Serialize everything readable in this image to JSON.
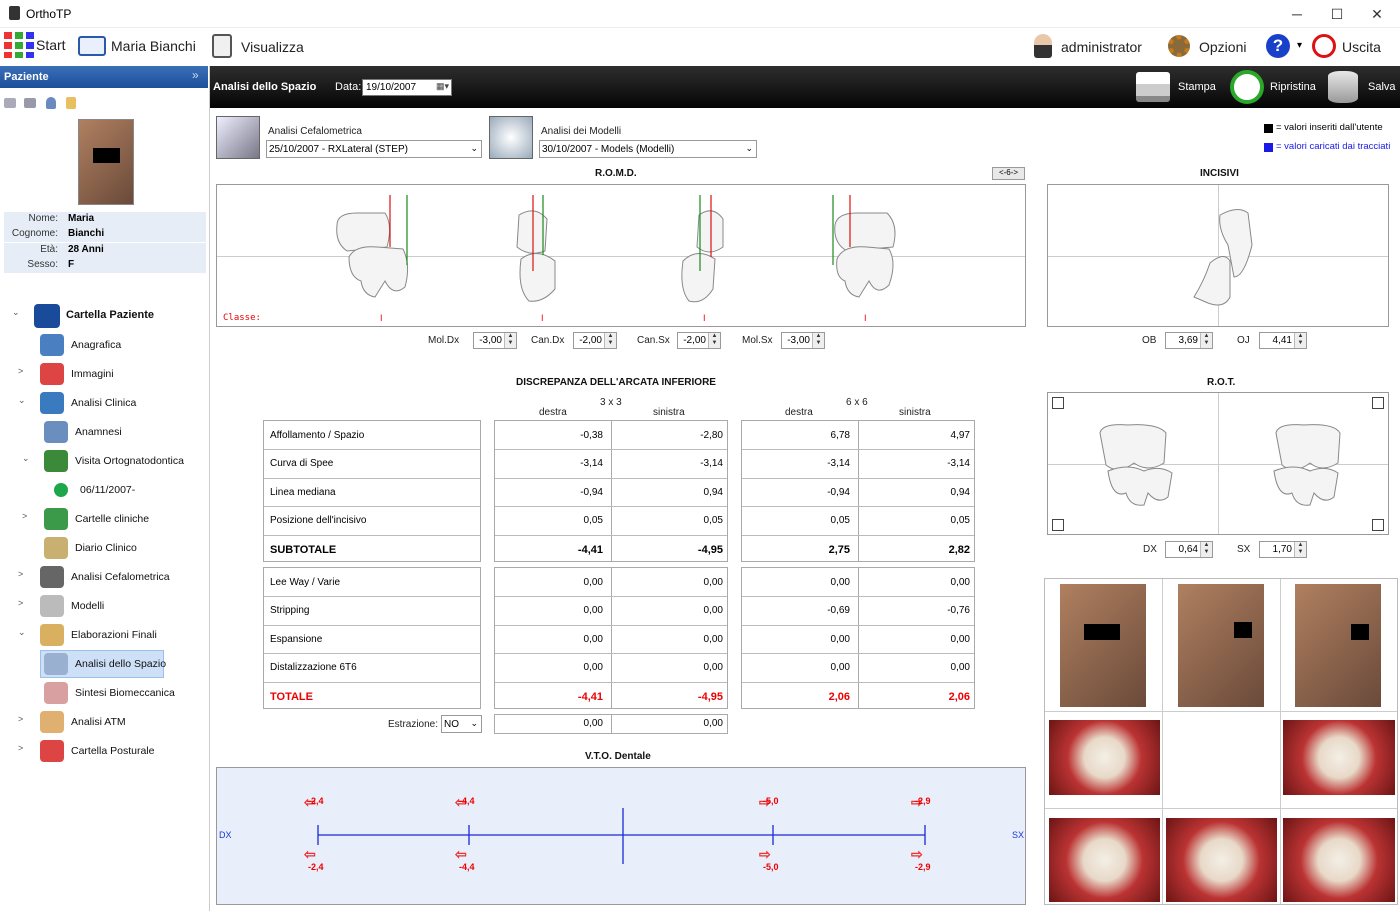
{
  "app": {
    "title": "OrthoTP"
  },
  "window": {
    "min": "─",
    "max": "☐",
    "close": "✕"
  },
  "menu": {
    "start": "Start",
    "patient": "Maria Bianchi",
    "view": "Visualizza",
    "user": "administrator",
    "options": "Opzioni",
    "help_arrow": "▾",
    "exit": "Uscita"
  },
  "sidebar": {
    "header": "Paziente",
    "chevron": "»",
    "info": [
      {
        "k": "Nome:",
        "v": "Maria"
      },
      {
        "k": "Cognome:",
        "v": "Bianchi"
      },
      {
        "k": "Età:",
        "v": "28 Anni"
      },
      {
        "k": "Sesso:",
        "v": "F"
      }
    ],
    "tree": [
      {
        "label": "Cartella Paziente",
        "arrow": "⌄",
        "icon": "folder-patient-icon",
        "color": "#1a4a9a"
      },
      {
        "label": "Anagrafica",
        "arrow": "",
        "icon": "person-icon",
        "color": "#4a7fc1"
      },
      {
        "label": "Immagini",
        "arrow": ">",
        "icon": "images-icon",
        "color": "#d44"
      },
      {
        "label": "Analisi Clinica",
        "arrow": "⌄",
        "icon": "stethoscope-icon",
        "color": "#3a7bbf"
      },
      {
        "label": "Anamnesi",
        "arrow": "",
        "icon": "clipboard-icon",
        "color": "#6a8fbf"
      },
      {
        "label": "Visita Ortognatodontica",
        "arrow": "⌄",
        "icon": "doctor-icon",
        "color": "#3a8a3a"
      },
      {
        "label": "06/11/2007-",
        "arrow": "",
        "icon": "green-dot-icon",
        "color": "#1ca84a"
      },
      {
        "label": "Cartelle cliniche",
        "arrow": ">",
        "icon": "clinic-records-icon",
        "color": "#3a9a4a"
      },
      {
        "label": "Diario Clinico",
        "arrow": "",
        "icon": "diary-icon",
        "color": "#c8b070"
      },
      {
        "label": "Analisi Cefalometrica",
        "arrow": ">",
        "icon": "skull-icon",
        "color": "#666"
      },
      {
        "label": "Modelli",
        "arrow": ">",
        "icon": "teeth-model-icon",
        "color": "#bbb"
      },
      {
        "label": "Elaborazioni Finali",
        "arrow": "⌄",
        "icon": "head-icon",
        "color": "#d8b060"
      },
      {
        "label": "Analisi dello Spazio",
        "arrow": "",
        "icon": "space-analysis-icon",
        "color": "#9ab0d0"
      },
      {
        "label": "Sintesi Biomeccanica",
        "arrow": "",
        "icon": "biomech-icon",
        "color": "#d8a0a0"
      },
      {
        "label": "Analisi ATM",
        "arrow": ">",
        "icon": "atm-icon",
        "color": "#e0b070"
      },
      {
        "label": "Cartella Posturale",
        "arrow": ">",
        "icon": "posture-icon",
        "color": "#d44"
      }
    ]
  },
  "header": {
    "title": "Analisi dello Spazio",
    "date_label": "Data:",
    "date_value": "19/10/2007",
    "print": "Stampa",
    "restore": "Ripristina",
    "save": "Salva"
  },
  "sources": {
    "ceph_label": "Analisi Cefalometrica",
    "ceph_value": "25/10/2007  - RXLateral (STEP)",
    "models_label": "Analisi dei Modelli",
    "models_value": "30/10/2007  - Models (Modelli)"
  },
  "legend": {
    "user": "= valori inseriti dall'utente",
    "traced": "= valori caricati dai tracciati",
    "user_color": "#000000",
    "traced_color": "#1a1ae6"
  },
  "romd": {
    "title": "R.O.M.D.",
    "toggle": "<-6->",
    "classe_label": "Classe:",
    "classes": [
      "I",
      "I",
      "I",
      "I"
    ],
    "fields": [
      {
        "label": "Mol.Dx",
        "value": "-3,00"
      },
      {
        "label": "Can.Dx",
        "value": "-2,00"
      },
      {
        "label": "Can.Sx",
        "value": "-2,00"
      },
      {
        "label": "Mol.Sx",
        "value": "-3,00"
      }
    ]
  },
  "incisivi": {
    "title": "INCISIVI",
    "ob_label": "OB",
    "ob_value": "3,69",
    "oj_label": "OJ",
    "oj_value": "4,41"
  },
  "rot": {
    "title": "R.O.T.",
    "dx_label": "DX",
    "dx_value": "0,64",
    "sx_label": "SX",
    "sx_value": "1,70"
  },
  "discrepanza": {
    "title": "DISCREPANZA DELL'ARCATA INFERIORE",
    "g1": "3 x 3",
    "g2": "6 x 6",
    "destra": "destra",
    "sinistra": "sinistra",
    "rows1": [
      {
        "label": "Affollamento / Spazio",
        "v": [
          "-0,38",
          "-2,80",
          "6,78",
          "4,97"
        ]
      },
      {
        "label": "Curva di Spee",
        "v": [
          "-3,14",
          "-3,14",
          "-3,14",
          "-3,14"
        ]
      },
      {
        "label": "Linea mediana",
        "v": [
          "-0,94",
          "0,94",
          "-0,94",
          "0,94"
        ]
      },
      {
        "label": "Posizione dell'incisivo",
        "v": [
          "0,05",
          "0,05",
          "0,05",
          "0,05"
        ]
      },
      {
        "label": "SUBTOTALE",
        "v": [
          "-4,41",
          "-4,95",
          "2,75",
          "2,82"
        ]
      }
    ],
    "rows2": [
      {
        "label": "Lee Way / Varie",
        "v": [
          "0,00",
          "0,00",
          "0,00",
          "0,00"
        ]
      },
      {
        "label": "Stripping",
        "v": [
          "0,00",
          "0,00",
          "-0,69",
          "-0,76"
        ]
      },
      {
        "label": "Espansione",
        "v": [
          "0,00",
          "0,00",
          "0,00",
          "0,00"
        ]
      },
      {
        "label": "Distalizzazione 6T6",
        "v": [
          "0,00",
          "0,00",
          "0,00",
          "0,00"
        ]
      },
      {
        "label": "TOTALE",
        "v": [
          "-4,41",
          "-4,95",
          "2,06",
          "2,06"
        ]
      }
    ],
    "estrazione_label": "Estrazione:",
    "estrazione_value": "NO",
    "estr_v": [
      "0,00",
      "0,00"
    ]
  },
  "vto": {
    "title": "V.T.O. Dentale",
    "dx": "DX",
    "sx": "SX",
    "top": [
      "-2,4",
      "-4,4",
      "-5,0",
      "-2,9"
    ],
    "bottom": [
      "-2,4",
      "-4,4",
      "-5,0",
      "-2,9"
    ]
  }
}
